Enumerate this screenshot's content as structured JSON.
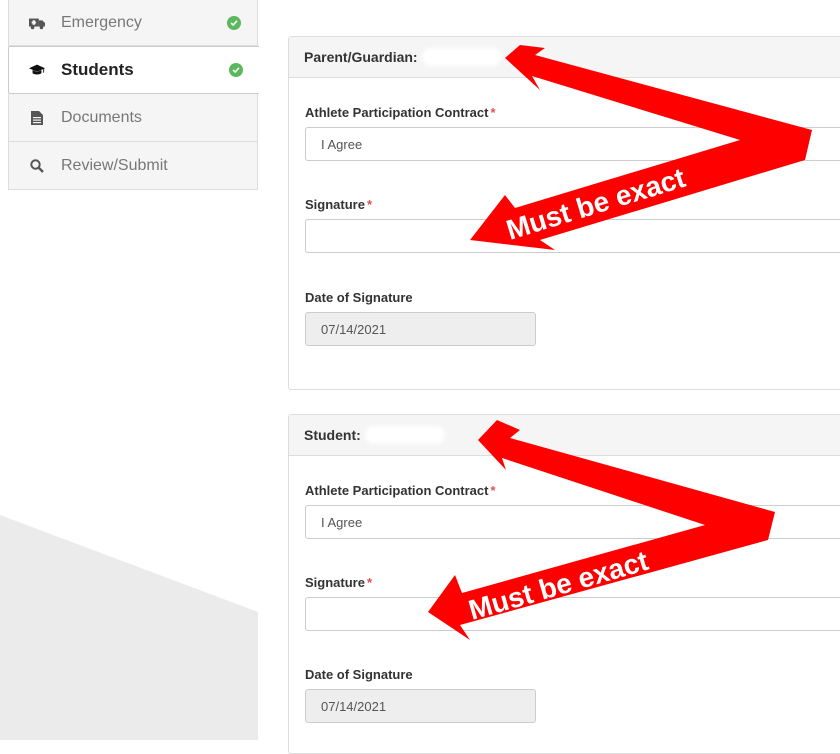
{
  "sidebar": {
    "items": [
      {
        "label": "Emergency",
        "icon": "ambulance-icon",
        "done": true
      },
      {
        "label": "Students",
        "icon": "graduation-cap-icon",
        "done": true
      },
      {
        "label": "Documents",
        "icon": "file-icon",
        "done": false
      },
      {
        "label": "Review/Submit",
        "icon": "search-icon",
        "done": false
      }
    ]
  },
  "panels": [
    {
      "heading": "Parent/Guardian:",
      "contract_label": "Athlete Participation Contract",
      "contract_value": "I Agree",
      "signature_label": "Signature",
      "signature_value": "",
      "date_label": "Date of Signature",
      "date_value": "07/14/2021"
    },
    {
      "heading": "Student:",
      "contract_label": "Athlete Participation Contract",
      "contract_value": "I Agree",
      "signature_label": "Signature",
      "signature_value": "",
      "date_label": "Date of Signature",
      "date_value": "07/14/2021"
    }
  ],
  "annotation": {
    "text": "Must be exact",
    "color": "#ff0000"
  },
  "required_marker": "*",
  "colors": {
    "success": "#5cb85c",
    "required": "#d9534f"
  }
}
